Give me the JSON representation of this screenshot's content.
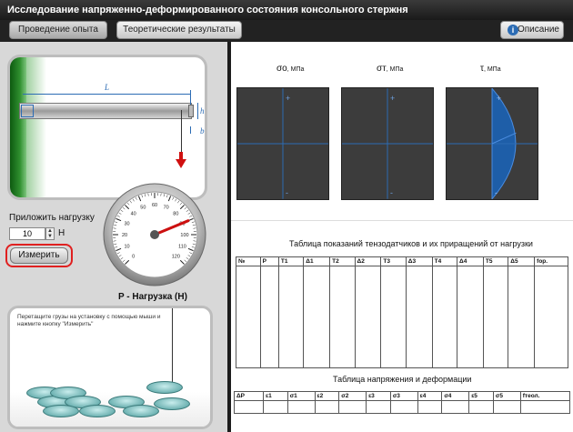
{
  "app": {
    "title": "Исследование напряженно-деформированного состояния консольного стержня"
  },
  "toolbar": {
    "experiment_label": "Проведение опыта",
    "theory_label": "Теоретические результаты",
    "description_label": "Описание",
    "info_glyph": "i"
  },
  "beam": {
    "length_label": "L",
    "height_label": "h",
    "width_label": "b"
  },
  "load": {
    "label": "Приложить нагрузку",
    "value": "10",
    "unit": "Н",
    "measure_label": "Измерить"
  },
  "gauge": {
    "caption": "P - Нагрузка (Н)",
    "ticks": [
      "0",
      "10",
      "20",
      "30",
      "40",
      "50",
      "60",
      "70",
      "80",
      "90",
      "100",
      "110",
      "120"
    ],
    "needle_value": 90,
    "max": 120
  },
  "weights": {
    "instruction": "Перетащите грузы на установку с помощью мыши и нажмите кнопку \"Измерить\""
  },
  "plots": {
    "sigma_o": {
      "symbol": "σo",
      "unit": ", МПа"
    },
    "sigma_t": {
      "symbol": "σт",
      "unit": ", МПа"
    },
    "tau": {
      "symbol": "τ",
      "unit": ", МПа"
    },
    "plus": "+",
    "minus": "-"
  },
  "table1": {
    "title": "Таблица показаний тензодатчиков и их приращений от нагрузки",
    "headers": [
      "№",
      "P",
      "T1",
      "Δ1",
      "T2",
      "Δ2",
      "T3",
      "Δ3",
      "T4",
      "Δ4",
      "T5",
      "Δ5",
      "fop."
    ]
  },
  "table2": {
    "title": "Таблица напряжения и деформации",
    "headers": [
      "ΔP",
      "ε1",
      "σ1",
      "ε2",
      "σ2",
      "ε3",
      "σ3",
      "ε4",
      "σ4",
      "ε5",
      "σ5",
      "fтеол."
    ]
  },
  "colors": {
    "accent_blue": "#2c6cb4",
    "alert_red": "#e02020",
    "plot_bg": "#3c3c3c"
  }
}
